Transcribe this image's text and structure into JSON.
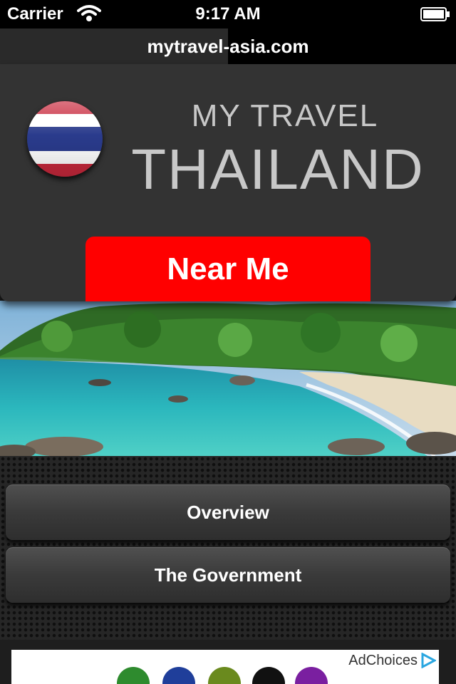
{
  "status_bar": {
    "carrier": "Carrier",
    "time": "9:17 AM",
    "wifi_icon": "wifi-icon",
    "battery_icon": "battery-icon"
  },
  "url_bar": {
    "url": "mytravel-asia.com"
  },
  "header": {
    "title_small": "MY TRAVEL",
    "title_big": "THAILAND",
    "flag_icon": "thailand-flag-icon",
    "near_me_label": "Near Me"
  },
  "menu": {
    "items": [
      {
        "label": "Overview"
      },
      {
        "label": "The Government"
      }
    ]
  },
  "ad": {
    "adchoices_label": "AdChoices"
  },
  "colors": {
    "accent_red": "#ff0000",
    "panel": "#333333",
    "title_text": "#c8c8c8"
  }
}
